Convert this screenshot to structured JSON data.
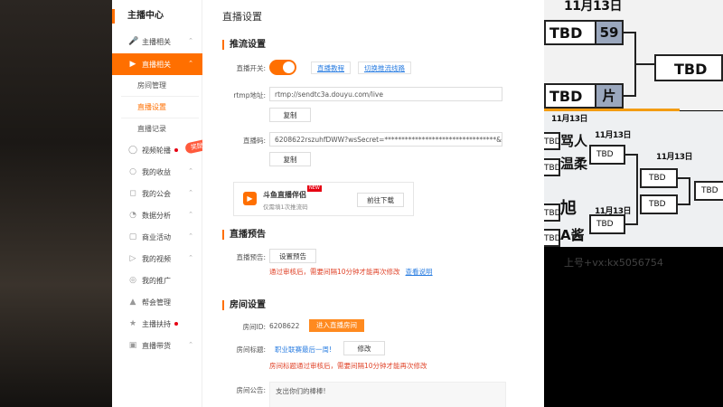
{
  "sidebar": {
    "title": "主播中心",
    "items": [
      {
        "label": "主播相关",
        "icon": "mic-icon"
      },
      {
        "label": "直播相关",
        "icon": "live-icon",
        "active": true
      },
      {
        "label": "视频轮播",
        "icon": "video-loop-icon"
      },
      {
        "label": "我的收益",
        "icon": "income-icon"
      },
      {
        "label": "我的公会",
        "icon": "guild-icon"
      },
      {
        "label": "数据分析",
        "icon": "chart-icon"
      },
      {
        "label": "商业活动",
        "icon": "business-icon"
      },
      {
        "label": "我的视频",
        "icon": "my-video-icon"
      },
      {
        "label": "我的推广",
        "icon": "promo-icon"
      },
      {
        "label": "帮会管理",
        "icon": "gang-icon"
      },
      {
        "label": "主播扶持",
        "icon": "support-icon"
      },
      {
        "label": "直播带货",
        "icon": "shop-icon"
      }
    ],
    "subitems": [
      "房间管理",
      "直播设置",
      "直播记录"
    ],
    "reward_badge": "奖励"
  },
  "main": {
    "page_title": "直播设置",
    "stream": {
      "section_title": "推流设置",
      "switch_label": "直播开关:",
      "tutorial_link": "直播教程",
      "switch_line_link": "切换推流线路",
      "rtmp_label": "rtmp地址:",
      "rtmp_value": "rtmp://sendtc3a.douyu.com/live",
      "copy_label": "复制",
      "code_label": "直播码:",
      "code_value": "6208622rszuhfDWW?wsSecret=*********************************&ws1",
      "promo_name": "斗鱼直播伴侣",
      "promo_new": "NEW",
      "promo_desc": "仅需填1次推流码",
      "promo_download": "前往下载"
    },
    "preview": {
      "section_title": "直播预告",
      "label": "直播预告:",
      "button": "设置预告",
      "notice": "通过审核后，需要间隔10分钟才能再次修改",
      "help_link": "查看说明"
    },
    "room": {
      "section_title": "房间设置",
      "id_label": "房间ID:",
      "id_value": "6208622",
      "enter_button": "进入直播房间",
      "title_label": "房间标题:",
      "title_value": "职业联赛最后一周!",
      "modify_button": "修改",
      "title_notice": "房间标题通过审核后，需要间隔10分钟才能再次修改",
      "announce_label": "房间公告:",
      "announce_value": "支出你们的棒棒!"
    }
  },
  "bracket": {
    "date_label": "11月13日",
    "tbd": "TBD",
    "score_top": "59",
    "score_bottom": "片",
    "cn_a": "骂人",
    "cn_b": "温柔",
    "cn_c": "旭",
    "cn_d": "A酱",
    "watermark": "上号+vx:kx5056754"
  },
  "colors": {
    "accent": "#ff6f00",
    "link": "#2a7de1",
    "warn": "#e0442a"
  }
}
